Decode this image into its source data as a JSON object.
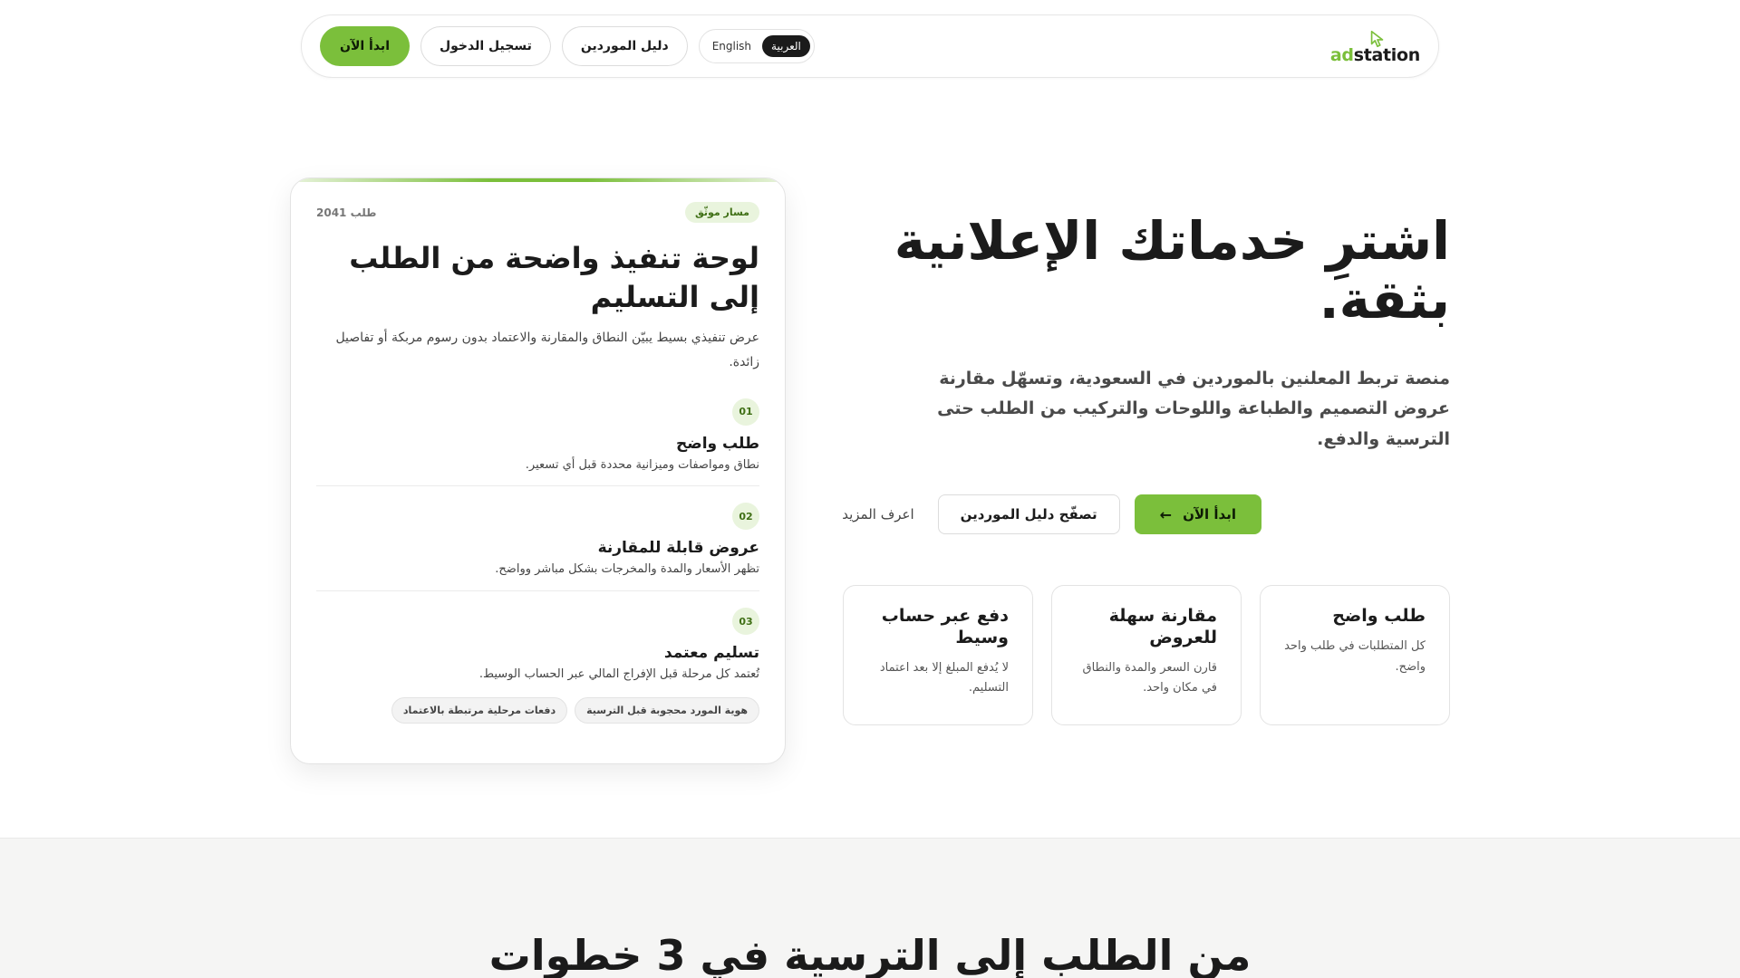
{
  "header": {
    "logo_ad": "ad",
    "logo_station": "station",
    "start_label": "ابدأ الآن",
    "login_label": "تسجيل الدخول",
    "directory_label": "دليل الموردين",
    "lang_en": "English",
    "lang_ar": "العربية"
  },
  "hero": {
    "title": "اشترِ خدماتك الإعلانية بثقة.",
    "description": "منصة تربط المعلنين بالموردين في السعودية، وتسهّل مقارنة عروض التصميم والطباعة واللوحات والتركيب من الطلب حتى الترسية والدفع.",
    "primary_cta": "ابدأ الآن",
    "secondary_cta": "تصفّح دليل الموردين",
    "more_link": "اعرف المزيد"
  },
  "features": [
    {
      "title": "طلب واضح",
      "text": "كل المتطلبات في طلب واحد واضح."
    },
    {
      "title": "مقارنة سهلة للعروض",
      "text": "قارن السعر والمدة والنطاق في مكان واحد."
    },
    {
      "title": "دفع عبر حساب وسيط",
      "text": "لا يُدفع المبلغ إلا بعد اعتماد التسليم."
    }
  ],
  "panel": {
    "badge": "مسار موثّق",
    "order": "طلب 2041",
    "title": "لوحة تنفيذ واضحة من الطلب إلى التسليم",
    "description": "عرض تنفيذي بسيط يبيّن النطاق والمقارنة والاعتماد بدون رسوم مربكة أو تفاصيل زائدة.",
    "steps": [
      {
        "num": "01",
        "title": "طلب واضح",
        "text": "نطاق ومواصفات وميزانية محددة قبل أي تسعير."
      },
      {
        "num": "02",
        "title": "عروض قابلة للمقارنة",
        "text": "تظهر الأسعار والمدة والمخرجات بشكل مباشر وواضح."
      },
      {
        "num": "03",
        "title": "تسليم معتمد",
        "text": "تُعتمد كل مرحلة قبل الإفراج المالي عبر الحساب الوسيط."
      }
    ],
    "tags": [
      "هوية المورد محجوبة قبل الترسية",
      "دفعات مرحلية مرتبطة بالاعتماد"
    ]
  },
  "section": {
    "title": "من الطلب إلى الترسية في 3 خطوات"
  }
}
